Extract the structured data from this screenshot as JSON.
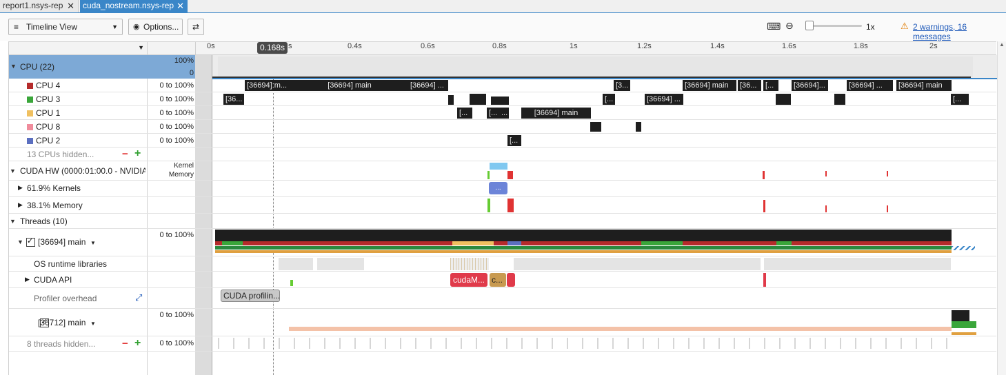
{
  "tabs": [
    {
      "label": "report1.nsys-rep",
      "active": false
    },
    {
      "label": "cuda_nostream.nsys-rep",
      "active": true
    }
  ],
  "toolbar": {
    "view_select": "Timeline View",
    "options_label": "Options...",
    "zoom_label": "1x",
    "warnings_label": "2 warnings, 16 messages"
  },
  "timeline": {
    "cursor_label": "0.168s",
    "ticks": [
      "0s",
      "0.4s",
      "0.6s",
      "0.8s",
      "1s",
      "1.2s",
      "1.4s",
      "1.6s",
      "1.8s",
      "2s"
    ]
  },
  "rows": {
    "cpu_group": {
      "label": "CPU (22)",
      "range_top": "100%",
      "range_bottom": "0"
    },
    "cpus": [
      {
        "label": "CPU 4",
        "range": "0 to 100%",
        "color": "#b52b2b"
      },
      {
        "label": "CPU 3",
        "range": "0 to 100%",
        "color": "#3aa63a"
      },
      {
        "label": "CPU 1",
        "range": "0 to 100%",
        "color": "#f0c060"
      },
      {
        "label": "CPU 8",
        "range": "0 to 100%",
        "color": "#f08c9c"
      },
      {
        "label": "CPU 2",
        "range": "0 to 100%",
        "color": "#5b6fc0"
      }
    ],
    "cpus_hidden": "13 CPUs hidden...",
    "cuda_hw": {
      "label": "CUDA HW (0000:01:00.0 - NVIDIA I",
      "range_line1": "Kernel",
      "range_line2": "Memory"
    },
    "kernels": "61.9% Kernels",
    "memory": "38.1% Memory",
    "threads_group": "Threads (10)",
    "thread_main": {
      "label": "[36694] main",
      "range": "0 to 100%"
    },
    "os_runtime": "OS runtime libraries",
    "cuda_api": "CUDA API",
    "profiler_overhead": "Profiler overhead",
    "thread2": {
      "label": "[36712] main",
      "range": "0 to 100%"
    },
    "threads_hidden": {
      "label": "8 threads hidden...",
      "range": "0 to 100%"
    }
  },
  "blocks": {
    "cpu4": [
      "[36694]:m...",
      "[36694] main",
      "[36694] ...",
      "[3...",
      "[36694] main",
      "[36694] main",
      "[36...",
      "[...",
      "[36694]...",
      "[36694] ...",
      "[36694] main"
    ],
    "cpu3": [
      "[36...",
      "[...",
      "[36694] ...",
      "[..."
    ],
    "cpu1": [
      "[...",
      "[...",
      "...",
      "[36694] main"
    ],
    "cpu2": [
      "[..."
    ],
    "kernels_mark": "...",
    "cuda_api": [
      "cudaM...",
      "c..."
    ],
    "profiler": "CUDA profilin..."
  },
  "colors": {
    "accent": "#3a86c8",
    "selected_row": "#7da9d6",
    "warning": "#e07b00"
  }
}
